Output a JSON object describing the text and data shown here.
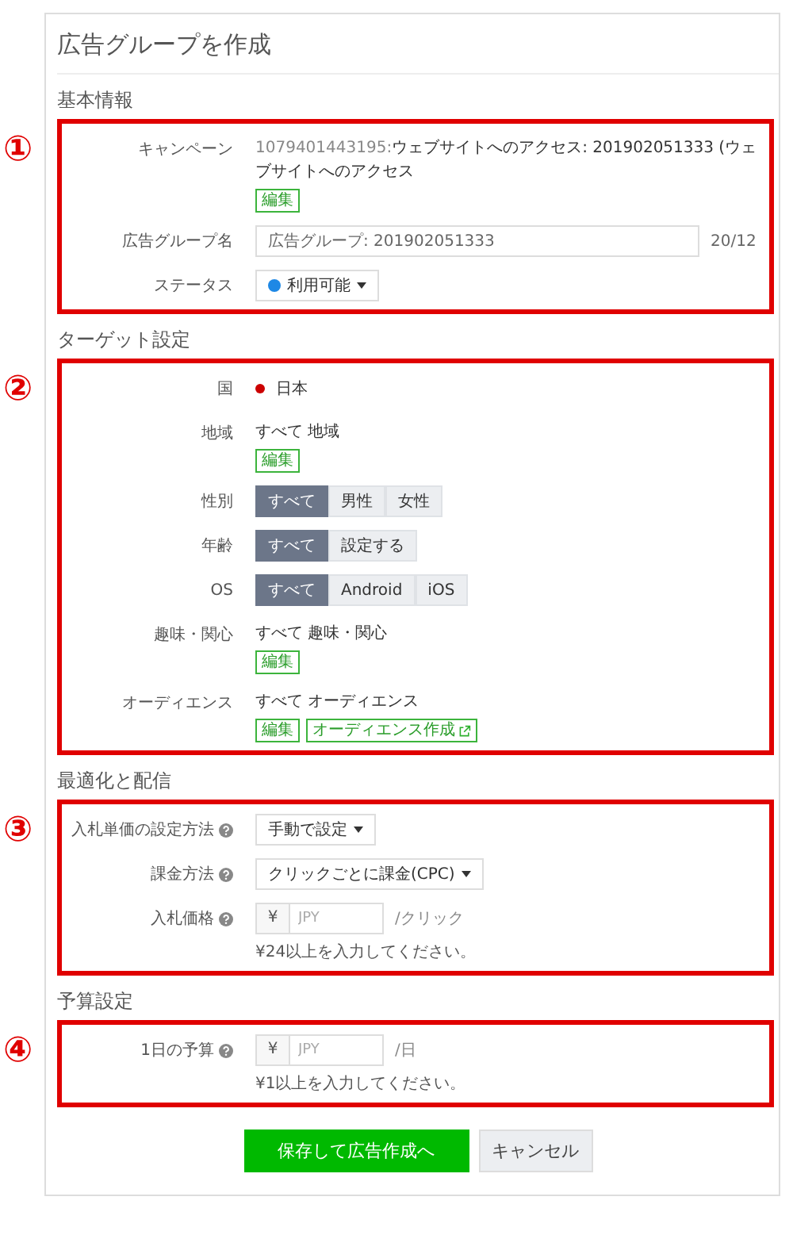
{
  "title": "広告グループを作成",
  "sections": [
    {
      "title": "基本情報",
      "marker": "①",
      "rows": [
        {
          "kind": "info",
          "label": "キャンペーン",
          "prefix": "1079401443195:",
          "value": "ウェブサイトへのアクセス: 201902051333 (ウェブサイトへのアクセス",
          "tags": [
            {
              "label": "編集",
              "external": false
            }
          ]
        },
        {
          "kind": "input",
          "label": "広告グループ名",
          "value": "広告グループ: 201902051333",
          "counter": "20/12"
        },
        {
          "kind": "dropdown",
          "label": "ステータス",
          "value": "利用可能",
          "color": "#1e88e5"
        }
      ]
    },
    {
      "title": "ターゲット設定",
      "marker": "②",
      "rows": [
        {
          "kind": "country",
          "label": "国",
          "value": "日本",
          "color": "#cc0000"
        },
        {
          "kind": "info",
          "label": "地域",
          "value": "すべて 地域",
          "tags": [
            {
              "label": "編集",
              "external": false
            }
          ]
        },
        {
          "kind": "segmented",
          "label": "性別",
          "options": [
            {
              "label": "すべて",
              "selected": true
            },
            {
              "label": "男性",
              "selected": false
            },
            {
              "label": "女性",
              "selected": false
            }
          ]
        },
        {
          "kind": "segmented",
          "label": "年齢",
          "options": [
            {
              "label": "すべて",
              "selected": true
            },
            {
              "label": "設定する",
              "selected": false
            }
          ]
        },
        {
          "kind": "segmented",
          "label": "OS",
          "options": [
            {
              "label": "すべて",
              "selected": true
            },
            {
              "label": "Android",
              "selected": false
            },
            {
              "label": "iOS",
              "selected": false
            }
          ]
        },
        {
          "kind": "info",
          "label": "趣味・関心",
          "value": "すべて 趣味・関心",
          "tags": [
            {
              "label": "編集",
              "external": false
            }
          ]
        },
        {
          "kind": "info",
          "label": "オーディエンス",
          "value": "すべて オーディエンス",
          "tags": [
            {
              "label": "編集",
              "external": false
            },
            {
              "label": "オーディエンス作成",
              "external": true
            }
          ]
        }
      ]
    },
    {
      "title": "最適化と配信",
      "marker": "③",
      "rows": [
        {
          "kind": "dropdown",
          "label": "入札単価の設定方法",
          "help": true,
          "value": "手動で設定"
        },
        {
          "kind": "dropdown",
          "label": "課金方法",
          "help": true,
          "value": "クリックごとに課金(CPC)"
        },
        {
          "kind": "price",
          "label": "入札価格",
          "help": true,
          "currency": "¥",
          "placeholder": "JPY",
          "unit": "/クリック",
          "hint": "¥24以上を入力してください。"
        }
      ]
    },
    {
      "title": "予算設定",
      "marker": "④",
      "rows": [
        {
          "kind": "price",
          "label": "1日の予算",
          "help": true,
          "currency": "¥",
          "placeholder": "JPY",
          "unit": "/日",
          "hint": "¥1以上を入力してください。"
        }
      ]
    }
  ],
  "buttons": [
    {
      "label": "保存して広告作成へ",
      "primary": true
    },
    {
      "label": "キャンセル",
      "primary": false
    }
  ]
}
